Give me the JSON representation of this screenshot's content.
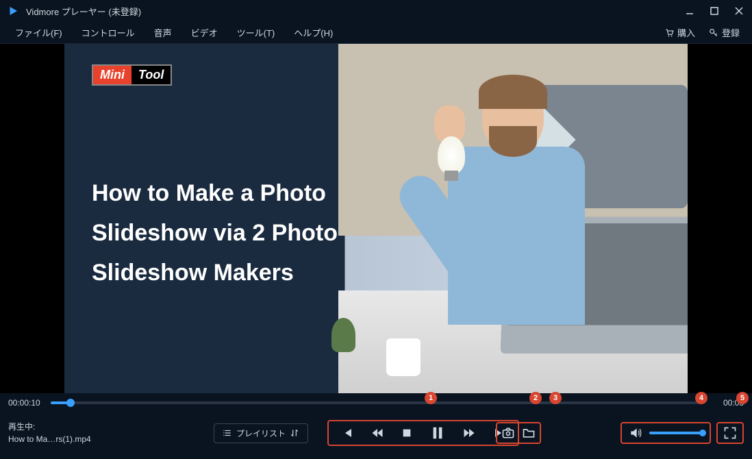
{
  "titlebar": {
    "title": "Vidmore プレーヤー (未登録)"
  },
  "menu": {
    "file": "ファイル(F)",
    "control": "コントロール",
    "audio": "音声",
    "video": "ビデオ",
    "tool": "ツール(T)",
    "help": "ヘルプ(H)",
    "buy": "購入",
    "register": "登録"
  },
  "video": {
    "logo_mini": "Mini",
    "logo_tool": "Tool",
    "title": "How to Make a Photo Slideshow via 2 Photo Slideshow Makers"
  },
  "progress": {
    "current": "00:00:10",
    "total": "00:05"
  },
  "nowplaying": {
    "label": "再生中:",
    "file": "How to Ma…rs(1).mp4"
  },
  "playlist": {
    "label": "プレイリスト"
  },
  "markers": {
    "m1": "1",
    "m2": "2",
    "m3": "3",
    "m4": "4",
    "m5": "5"
  }
}
